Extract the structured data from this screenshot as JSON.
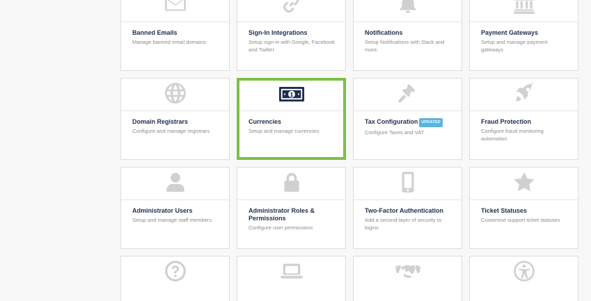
{
  "tiles": [
    {
      "title": "Banned Emails",
      "desc": "Manage banned email domains",
      "icon": "envelope-icon"
    },
    {
      "title": "Sign-In Integrations",
      "desc": "Setup sign-in with Google, Facebook and Twitter",
      "icon": "link-icon"
    },
    {
      "title": "Notifications",
      "desc": "Setup Notifications with Slack and more.",
      "icon": "bell-icon"
    },
    {
      "title": "Payment Gateways",
      "desc": "Setup and manage payment gateways",
      "icon": "bank-icon"
    },
    {
      "title": "Domain Registrars",
      "desc": "Configure and manage registrars",
      "icon": "globe-icon"
    },
    {
      "title": "Currencies",
      "desc": "Setup and manage currencies",
      "icon": "money-bill-icon"
    },
    {
      "title": "Tax Configuration",
      "badge": "UPDATED",
      "desc": "Configure Taxes and VAT",
      "icon": "gavel-icon"
    },
    {
      "title": "Fraud Protection",
      "desc": "Configure fraud monitoring automation",
      "icon": "rocket-icon"
    },
    {
      "title": "Administrator Users",
      "desc": "Setup and manage staff members",
      "icon": "user-icon"
    },
    {
      "title": "Administrator Roles & Permissions",
      "desc": "Configure user permissions",
      "icon": "lock-icon"
    },
    {
      "title": "Two-Factor Authentication",
      "desc": "Add a second layer of security to logins",
      "icon": "mobile-icon"
    },
    {
      "title": "Ticket Statuses",
      "desc": "Customise support ticket statuses",
      "icon": "star-icon"
    }
  ],
  "bottom_icons": [
    "question-circle-icon",
    "laptop-icon",
    "handshake-icon",
    "universal-access-icon"
  ],
  "colors": {
    "highlight_border": "#7ac143",
    "title": "#1f2d4e",
    "desc": "#8c8c8c",
    "icon": "#d0d0d0",
    "money_icon": "#1f2d4e",
    "badge": "#5bb3e0"
  }
}
